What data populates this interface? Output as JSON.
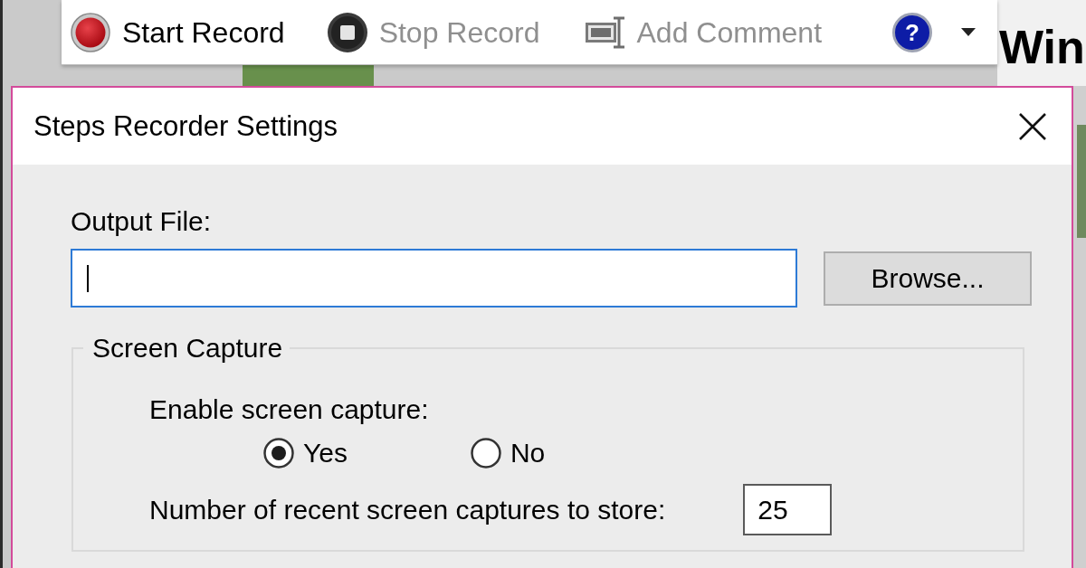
{
  "background": {
    "heading": "Win"
  },
  "toolbar": {
    "buttons": [
      {
        "kind": "record",
        "label": "Start Record",
        "disabled": false
      },
      {
        "kind": "stop",
        "label": "Stop Record",
        "disabled": true
      },
      {
        "kind": "comment",
        "label": "Add Comment",
        "disabled": true
      }
    ],
    "help": {
      "symbol": "?"
    }
  },
  "dialog": {
    "title": "Steps Recorder Settings",
    "output_file": {
      "label": "Output File:",
      "focused": true
    },
    "browse_button": {
      "label": "Browse..."
    },
    "screen_capture": {
      "legend": "Screen Capture",
      "enable_label": "Enable screen capture:",
      "options": [
        {
          "label": "Yes",
          "selected": true
        },
        {
          "label": "No",
          "selected": false
        }
      ],
      "count_label": "Number of recent screen captures to store:",
      "count_value": "25"
    }
  }
}
